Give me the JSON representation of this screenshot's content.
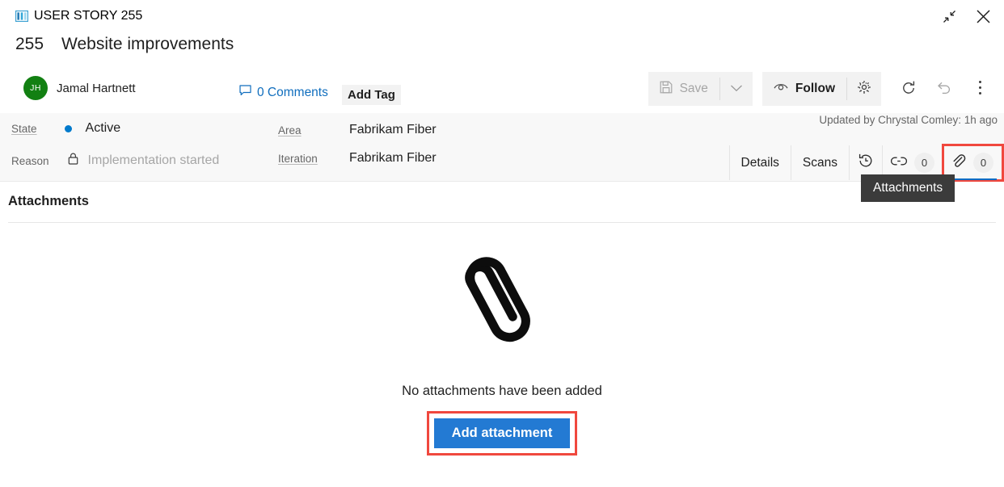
{
  "window": {
    "work_item_type": "USER STORY 255",
    "type_icon": "user-story-book-icon",
    "restore_icon": "collapse-diagonal-icon",
    "close_icon": "close-x-icon"
  },
  "header": {
    "id": "255",
    "title": "Website improvements",
    "assignee": {
      "initials": "JH",
      "name": "Jamal Hartnett",
      "avatar_color": "#128012"
    },
    "comments_label": "0 Comments",
    "comments_icon": "comment-bubble-icon",
    "add_tag_label": "Add Tag"
  },
  "toolbar": {
    "save_label": "Save",
    "save_icon": "floppy-disk-icon",
    "save_enabled": false,
    "save_caret_icon": "chevron-down-icon",
    "follow_label": "Follow",
    "follow_icon": "eye-icon",
    "settings_icon": "gear-icon",
    "refresh_icon": "refresh-icon",
    "undo_icon": "undo-icon",
    "more_icon": "kebab-menu-icon"
  },
  "details": {
    "state": {
      "label": "State",
      "value": "Active",
      "dot_color": "#007acc"
    },
    "reason": {
      "label": "Reason",
      "value": "Implementation started",
      "locked": true,
      "lock_icon": "lock-icon"
    },
    "area": {
      "label": "Area",
      "value": "Fabrikam Fiber"
    },
    "iteration": {
      "label": "Iteration",
      "value": "Fabrikam Fiber"
    },
    "updated_by": "Updated by Chrystal Comley: 1h ago"
  },
  "tabs": [
    {
      "label": "Details",
      "icon": null,
      "badge": null,
      "active": false,
      "highlighted": false,
      "name": "tab-details"
    },
    {
      "label": "Scans",
      "icon": null,
      "badge": null,
      "active": false,
      "highlighted": false,
      "name": "tab-scans"
    },
    {
      "label": "",
      "icon": "history-clock-icon",
      "badge": null,
      "active": false,
      "highlighted": false,
      "name": "tab-history"
    },
    {
      "label": "",
      "icon": "link-icon",
      "badge": "0",
      "active": false,
      "highlighted": false,
      "name": "tab-links"
    },
    {
      "label": "",
      "icon": "paperclip-icon",
      "badge": "0",
      "active": true,
      "highlighted": true,
      "name": "tab-attachments"
    }
  ],
  "tooltip": {
    "text": "Attachments"
  },
  "content": {
    "section_title": "Attachments",
    "empty_icon": "paperclip-large-icon",
    "empty_text": "No attachments have been added",
    "add_button_label": "Add attachment",
    "add_button_color": "#237ad3",
    "highlight_color": "#f0483e"
  }
}
